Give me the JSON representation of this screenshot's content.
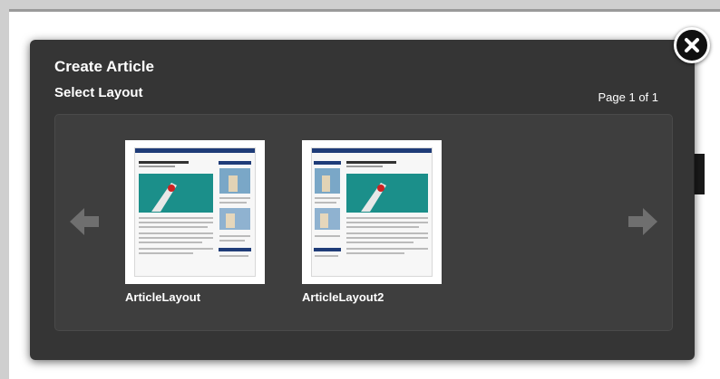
{
  "modal": {
    "title": "Create Article",
    "subtitle": "Select Layout",
    "page_indicator": "Page 1 of 1"
  },
  "layouts": [
    {
      "label": "ArticleLayout"
    },
    {
      "label": "ArticleLayout2"
    }
  ],
  "icons": {
    "close": "close-icon",
    "previous": "arrow-left-icon",
    "next": "arrow-right-icon"
  },
  "colors": {
    "modal_background": "#262626",
    "carousel_background": "#3e3e3e",
    "arrow": "#6f6f6f",
    "thumb_accent_blue": "#1f3c78",
    "thumb_image_teal": "#1b8f8a"
  }
}
